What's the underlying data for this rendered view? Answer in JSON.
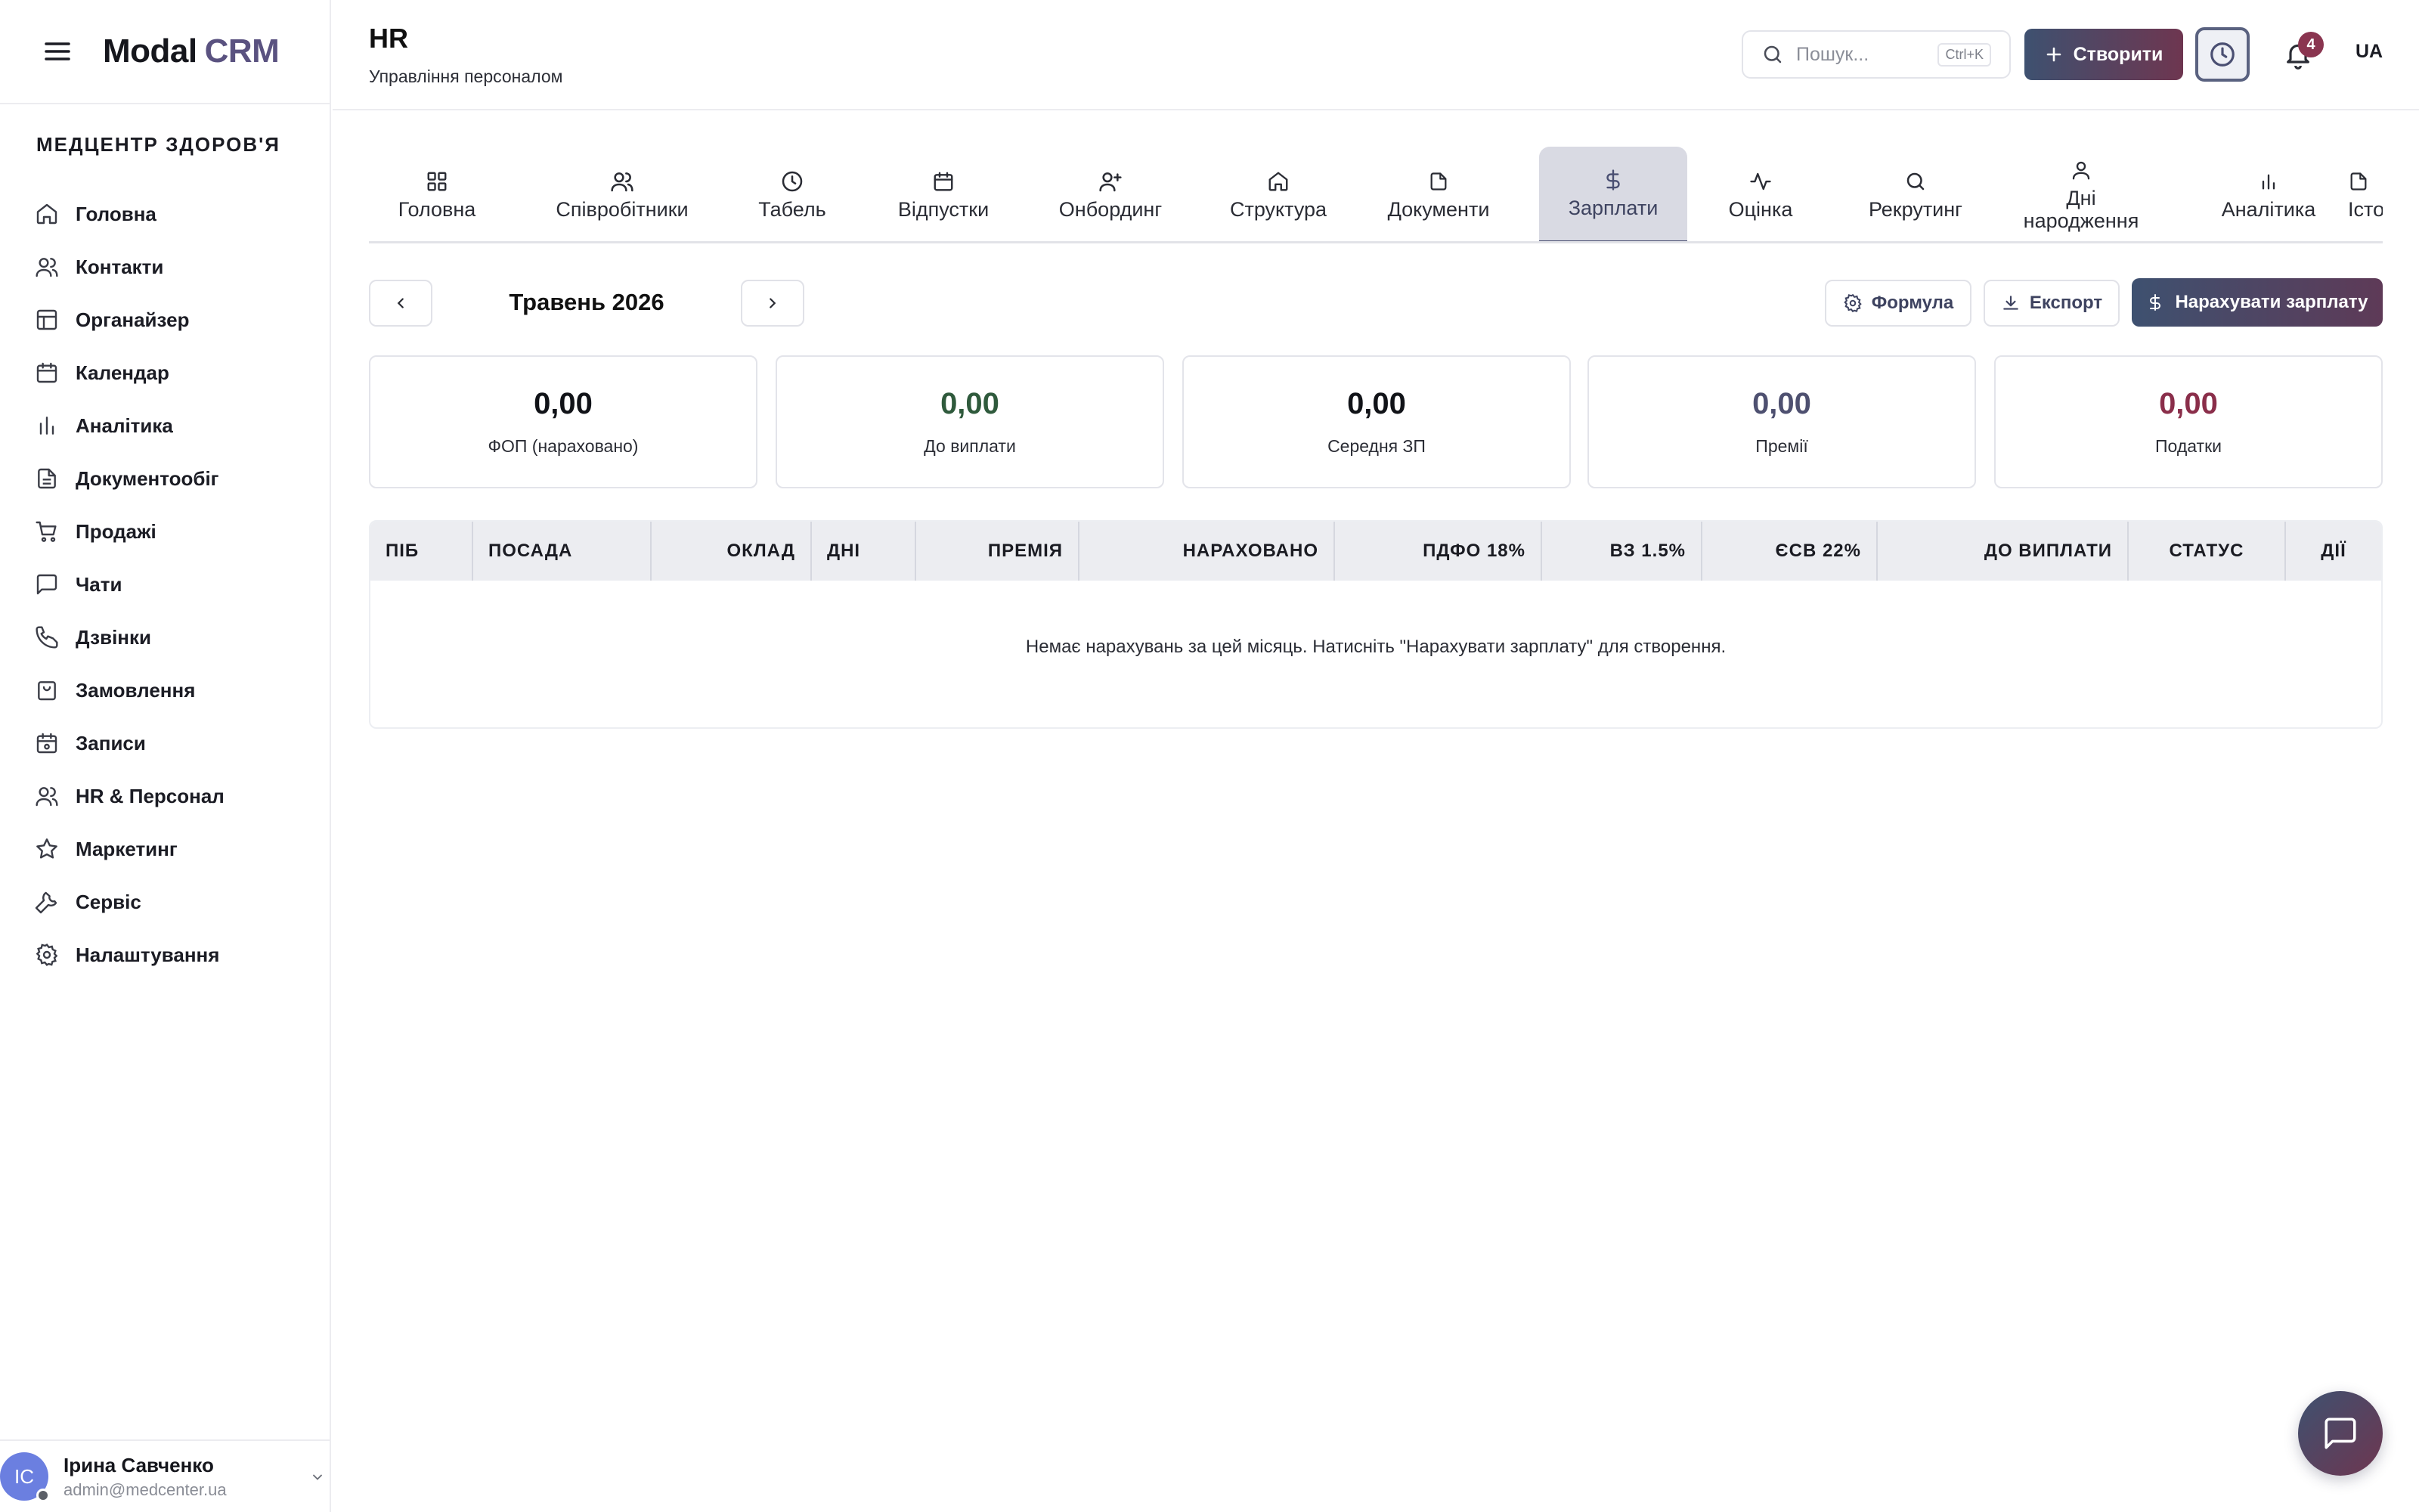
{
  "app": {
    "logo_primary": "Modal",
    "logo_accent": "CRM",
    "menu_icon": "hamburger-icon"
  },
  "sidebar": {
    "org_name": "МЕДЦЕНТР ЗДОРОВ'Я",
    "items": [
      {
        "label": "Головна",
        "icon": "home-icon"
      },
      {
        "label": "Контакти",
        "icon": "users-icon"
      },
      {
        "label": "Органайзер",
        "icon": "layout-icon"
      },
      {
        "label": "Календар",
        "icon": "calendar-icon"
      },
      {
        "label": "Аналітика",
        "icon": "bar-chart-icon"
      },
      {
        "label": "Документообіг",
        "icon": "document-icon"
      },
      {
        "label": "Продажі",
        "icon": "cart-icon"
      },
      {
        "label": "Чати",
        "icon": "chat-icon"
      },
      {
        "label": "Дзвінки",
        "icon": "phone-icon"
      },
      {
        "label": "Замовлення",
        "icon": "bag-icon"
      },
      {
        "label": "Записи",
        "icon": "calendar-check-icon"
      },
      {
        "label": "HR & Персонал",
        "icon": "users-icon"
      },
      {
        "label": "Маркетинг",
        "icon": "star-icon"
      },
      {
        "label": "Сервіс",
        "icon": "wrench-icon"
      },
      {
        "label": "Налаштування",
        "icon": "gear-icon"
      }
    ],
    "user": {
      "initials": "IC",
      "name": "Ірина Савченко",
      "email": "admin@medcenter.ua"
    }
  },
  "header": {
    "title": "HR",
    "subtitle": "Управління персоналом",
    "search_placeholder": "Пошук...",
    "search_shortcut": "Ctrl+K",
    "create_label": "Створити",
    "notifications_count": "4",
    "language": "UA"
  },
  "tabs": [
    {
      "label": "Головна",
      "icon": "grid-icon",
      "active": false
    },
    {
      "label": "Співробітники",
      "icon": "users-icon",
      "active": false
    },
    {
      "label": "Табель",
      "icon": "clock-icon",
      "active": false
    },
    {
      "label": "Відпустки",
      "icon": "calendar-icon",
      "active": false
    },
    {
      "label": "Онбординг",
      "icon": "user-plus-icon",
      "active": false
    },
    {
      "label": "Структура",
      "icon": "home-icon",
      "active": false
    },
    {
      "label": "Документи",
      "icon": "file-icon",
      "active": false
    },
    {
      "label": "Зарплати",
      "icon": "dollar-icon",
      "active": true
    },
    {
      "label": "Оцінка",
      "icon": "activity-icon",
      "active": false
    },
    {
      "label": "Рекрутинг",
      "icon": "search-icon",
      "active": false
    },
    {
      "label": "Дні народження",
      "icon": "user-icon",
      "active": false
    },
    {
      "label": "Аналітика",
      "icon": "bar-chart-icon",
      "active": false
    },
    {
      "label": "Істо",
      "icon": "file-icon",
      "active": false
    }
  ],
  "payroll": {
    "month": "Травень 2026",
    "formula_label": "Формула",
    "export_label": "Експорт",
    "accrue_label": "Нарахувати зарплату",
    "stats": [
      {
        "value": "0,00",
        "label": "ФОП (нараховано)",
        "color": "#111318"
      },
      {
        "value": "0,00",
        "label": "До виплати",
        "color": "#2f5a3c"
      },
      {
        "value": "0,00",
        "label": "Середня ЗП",
        "color": "#111318"
      },
      {
        "value": "0,00",
        "label": "Премії",
        "color": "#4e5070"
      },
      {
        "value": "0,00",
        "label": "Податки",
        "color": "#8a2e4a"
      }
    ],
    "table": {
      "columns": [
        "ПІБ",
        "ПОСАДА",
        "ОКЛАД",
        "ДНІ",
        "ПРЕМІЯ",
        "НАРАХОВАНО",
        "ПДФО 18%",
        "ВЗ 1.5%",
        "ЄСВ 22%",
        "ДО ВИПЛАТИ",
        "СТАТУС",
        "ДІЇ"
      ],
      "empty_message": "Немає нарахувань за цей місяць. Натисніть \"Нарахувати зарплату\" для створення."
    }
  },
  "colors": {
    "accent": "#4a4f72",
    "gradient_start": "#3e5170",
    "gradient_end": "#6e3650",
    "badge": "#8a3550"
  }
}
